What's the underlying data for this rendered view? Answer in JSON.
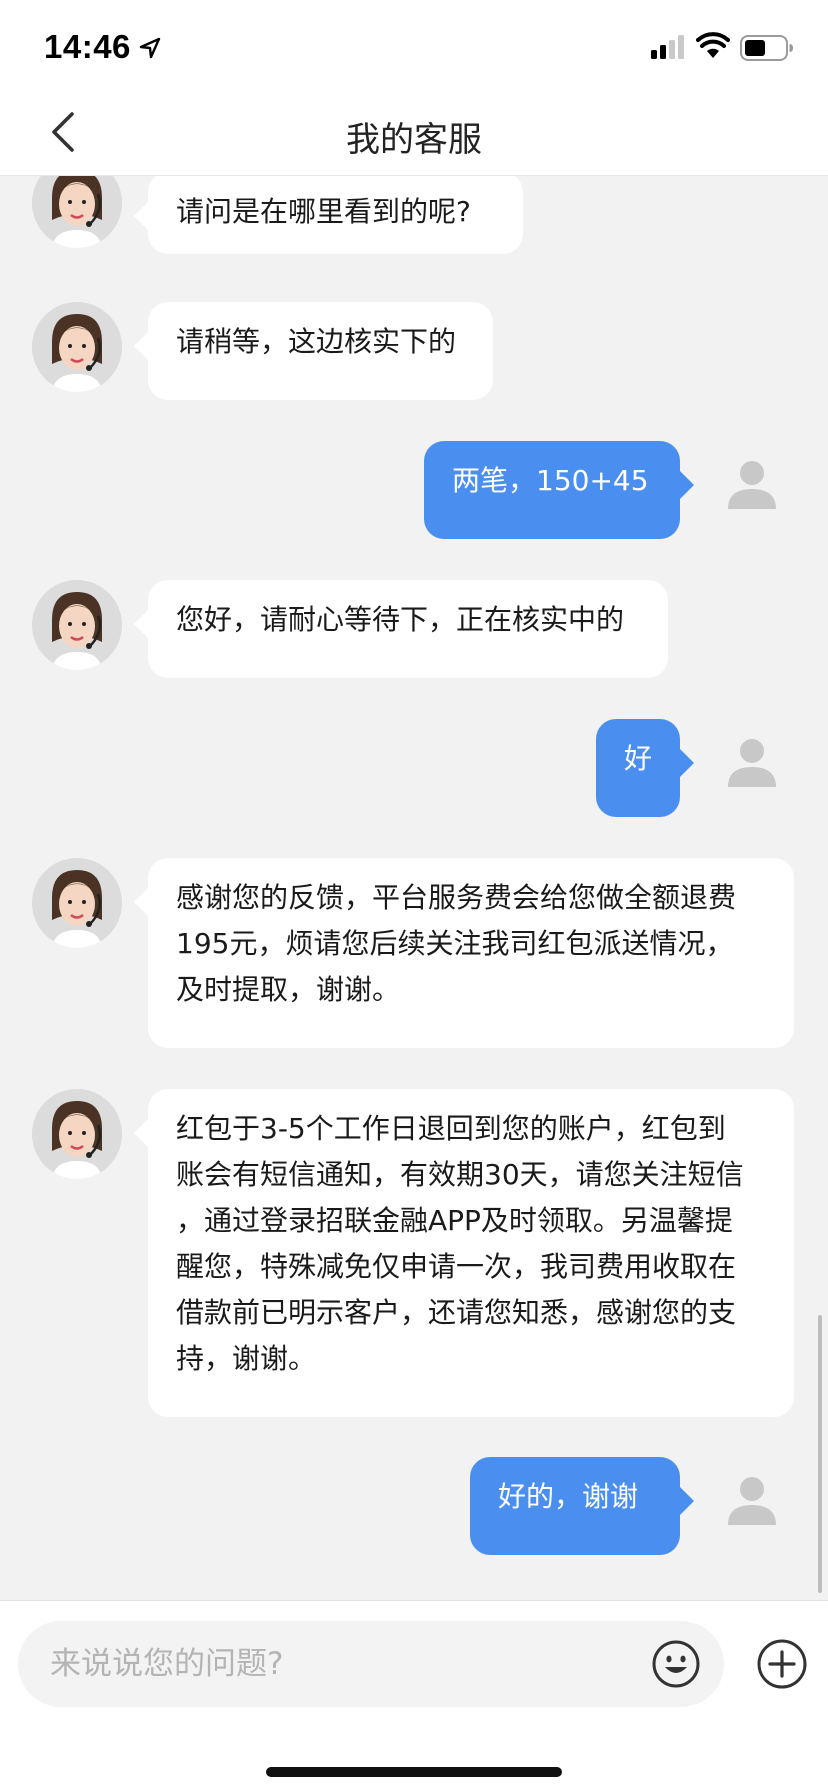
{
  "status_bar": {
    "time": "14:46",
    "icons": [
      "location-arrow-icon",
      "signal-icon",
      "wifi-icon",
      "battery-icon"
    ]
  },
  "header": {
    "title": "我的客服",
    "back_icon": "chevron-left-icon"
  },
  "messages": [
    {
      "sender": "agent",
      "text": "请问是在哪里看到的呢?"
    },
    {
      "sender": "agent",
      "text": "请稍等，这边核实下的"
    },
    {
      "sender": "user",
      "text": "两笔，150+45"
    },
    {
      "sender": "agent",
      "text": "您好，请耐心等待下，正在核实中的"
    },
    {
      "sender": "user",
      "text": "好"
    },
    {
      "sender": "agent",
      "lines": [
        "感谢您的反馈，平台服务费会给您做全额退费",
        "195元，烦请您后续关注我司红包派送情况，",
        "及时提取，谢谢。"
      ]
    },
    {
      "sender": "agent",
      "lines": [
        "红包于3-5个工作日退回到您的账户，红包到",
        "账会有短信通知，有效期30天，请您关注短信",
        "，通过登录招联金融APP及时领取。另温馨提",
        "醒您，特殊减免仅申请一次，我司费用收取在",
        "借款前已明示客户，还请您知悉，感谢您的支",
        "持，谢谢。"
      ]
    },
    {
      "sender": "user",
      "text": "好的，谢谢"
    }
  ],
  "input": {
    "placeholder": "来说说您的问题?",
    "emoji_icon": "smiley-icon",
    "plus_icon": "plus-circle-icon"
  },
  "colors": {
    "accent": "#4a8ff0",
    "background": "#f2f2f2",
    "bubble_in": "#ffffff"
  }
}
